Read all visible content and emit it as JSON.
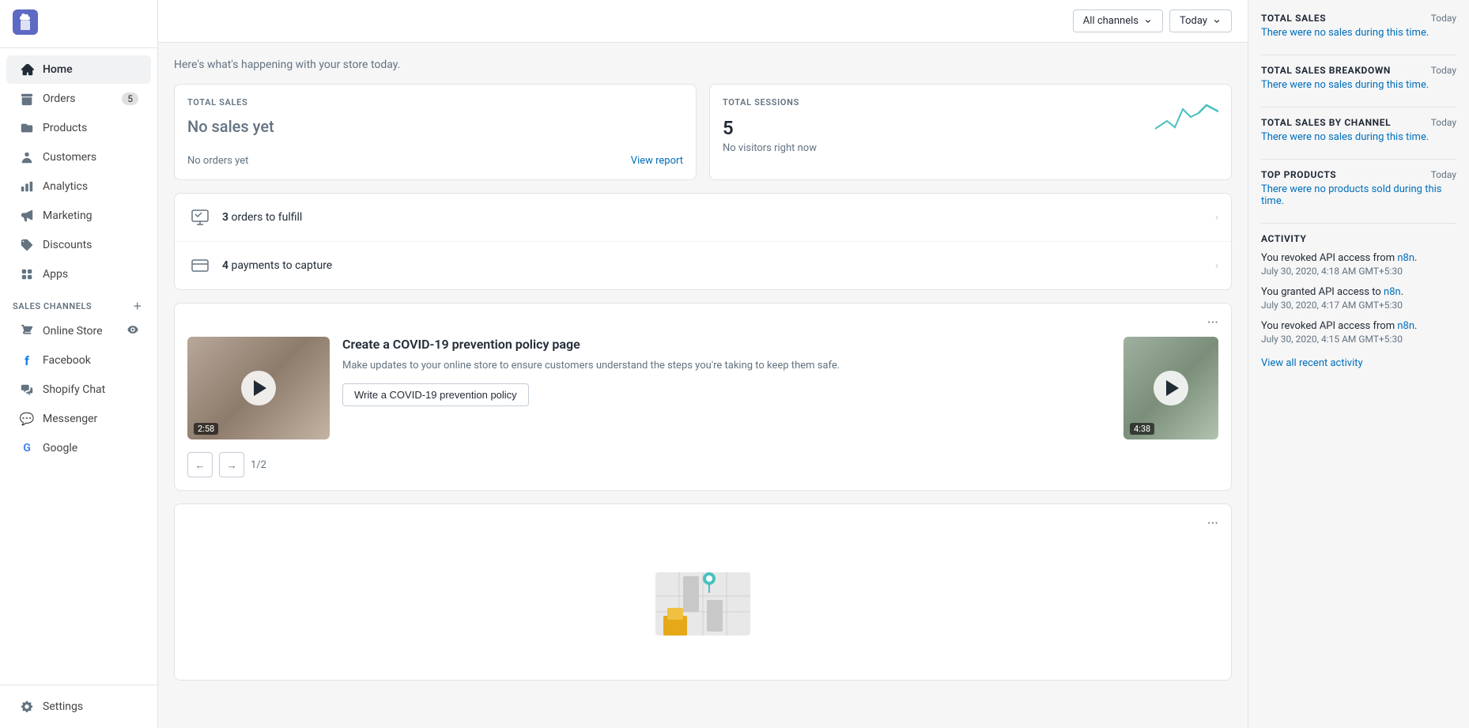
{
  "sidebar": {
    "nav_items": [
      {
        "id": "home",
        "label": "Home",
        "icon": "home",
        "active": true,
        "badge": null
      },
      {
        "id": "orders",
        "label": "Orders",
        "icon": "orders",
        "active": false,
        "badge": "5"
      },
      {
        "id": "products",
        "label": "Products",
        "icon": "products",
        "active": false,
        "badge": null
      },
      {
        "id": "customers",
        "label": "Customers",
        "icon": "customers",
        "active": false,
        "badge": null
      },
      {
        "id": "analytics",
        "label": "Analytics",
        "icon": "analytics",
        "active": false,
        "badge": null
      },
      {
        "id": "marketing",
        "label": "Marketing",
        "icon": "marketing",
        "active": false,
        "badge": null
      },
      {
        "id": "discounts",
        "label": "Discounts",
        "icon": "discounts",
        "active": false,
        "badge": null
      },
      {
        "id": "apps",
        "label": "Apps",
        "icon": "apps",
        "active": false,
        "badge": null
      }
    ],
    "sales_channels_label": "SALES CHANNELS",
    "channels": [
      {
        "id": "online-store",
        "label": "Online Store",
        "icon": "store",
        "has_eye": true
      },
      {
        "id": "facebook",
        "label": "Facebook",
        "icon": "facebook"
      },
      {
        "id": "shopify-chat",
        "label": "Shopify Chat",
        "icon": "chat"
      },
      {
        "id": "messenger",
        "label": "Messenger",
        "icon": "messenger"
      },
      {
        "id": "google",
        "label": "Google",
        "icon": "google"
      }
    ],
    "settings_label": "Settings"
  },
  "header": {
    "all_channels_label": "All channels",
    "today_label": "Today"
  },
  "main": {
    "greeting": "Here's what's happening with your store today.",
    "total_sales_card": {
      "label": "TOTAL SALES",
      "no_sales_text": "No sales yet",
      "no_orders_text": "No orders yet",
      "view_report_link": "View report"
    },
    "total_sessions_card": {
      "label": "TOTAL SESSIONS",
      "value": "5",
      "no_visitors_text": "No visitors right now"
    },
    "action_items": [
      {
        "id": "orders-fulfill",
        "count": "3",
        "text": "orders to fulfill"
      },
      {
        "id": "payments-capture",
        "count": "4",
        "text": "payments to capture"
      }
    ],
    "media_card": {
      "title": "Create a COVID-19 prevention policy page",
      "description": "Make updates to your online store to ensure customers understand the steps you're taking to keep them safe.",
      "button_label": "Write a COVID-19 prevention policy",
      "left_video_duration": "2:58",
      "right_video_duration": "4:38",
      "pagination": "1/2"
    }
  },
  "right_panel": {
    "total_sales": {
      "title": "TOTAL SALES",
      "meta": "Today",
      "text": "There were no sales during this time."
    },
    "total_sales_breakdown": {
      "title": "TOTAL SALES BREAKDOWN",
      "meta": "Today",
      "text": "There were no sales during this time."
    },
    "total_sales_by_channel": {
      "title": "TOTAL SALES BY CHANNEL",
      "meta": "Today",
      "text": "There were no sales during this time."
    },
    "top_products": {
      "title": "TOP PRODUCTS",
      "meta": "Today",
      "text": "There were no products sold during this time."
    },
    "activity": {
      "title": "ACTIVITY",
      "items": [
        {
          "text": "You revoked API access from n8n.",
          "link_text": "n8n",
          "time": "July 30, 2020, 4:18 AM GMT+5:30"
        },
        {
          "text": "You granted API access to n8n.",
          "link_text": "n8n",
          "time": "July 30, 2020, 4:17 AM GMT+5:30"
        },
        {
          "text": "You revoked API access from n8n.",
          "link_text": "n8n",
          "time": "July 30, 2020, 4:15 AM GMT+5:30"
        }
      ],
      "view_all_label": "View all recent activity"
    }
  }
}
